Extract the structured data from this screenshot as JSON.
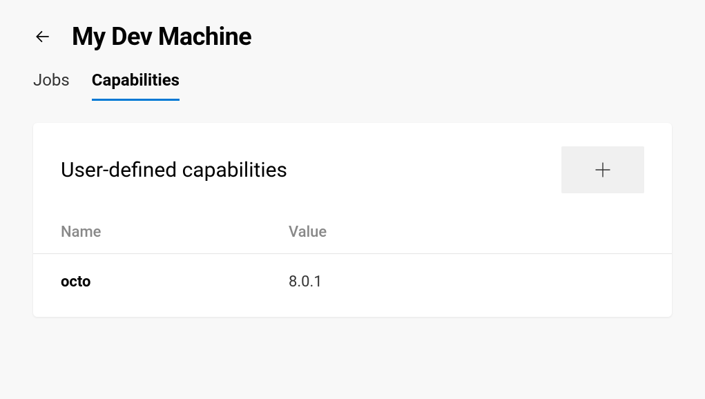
{
  "header": {
    "title": "My Dev Machine"
  },
  "tabs": [
    {
      "label": "Jobs",
      "active": false
    },
    {
      "label": "Capabilities",
      "active": true
    }
  ],
  "card": {
    "title": "User-defined capabilities",
    "columns": {
      "name": "Name",
      "value": "Value"
    },
    "rows": [
      {
        "name": "octo",
        "value": "8.0.1"
      }
    ]
  }
}
